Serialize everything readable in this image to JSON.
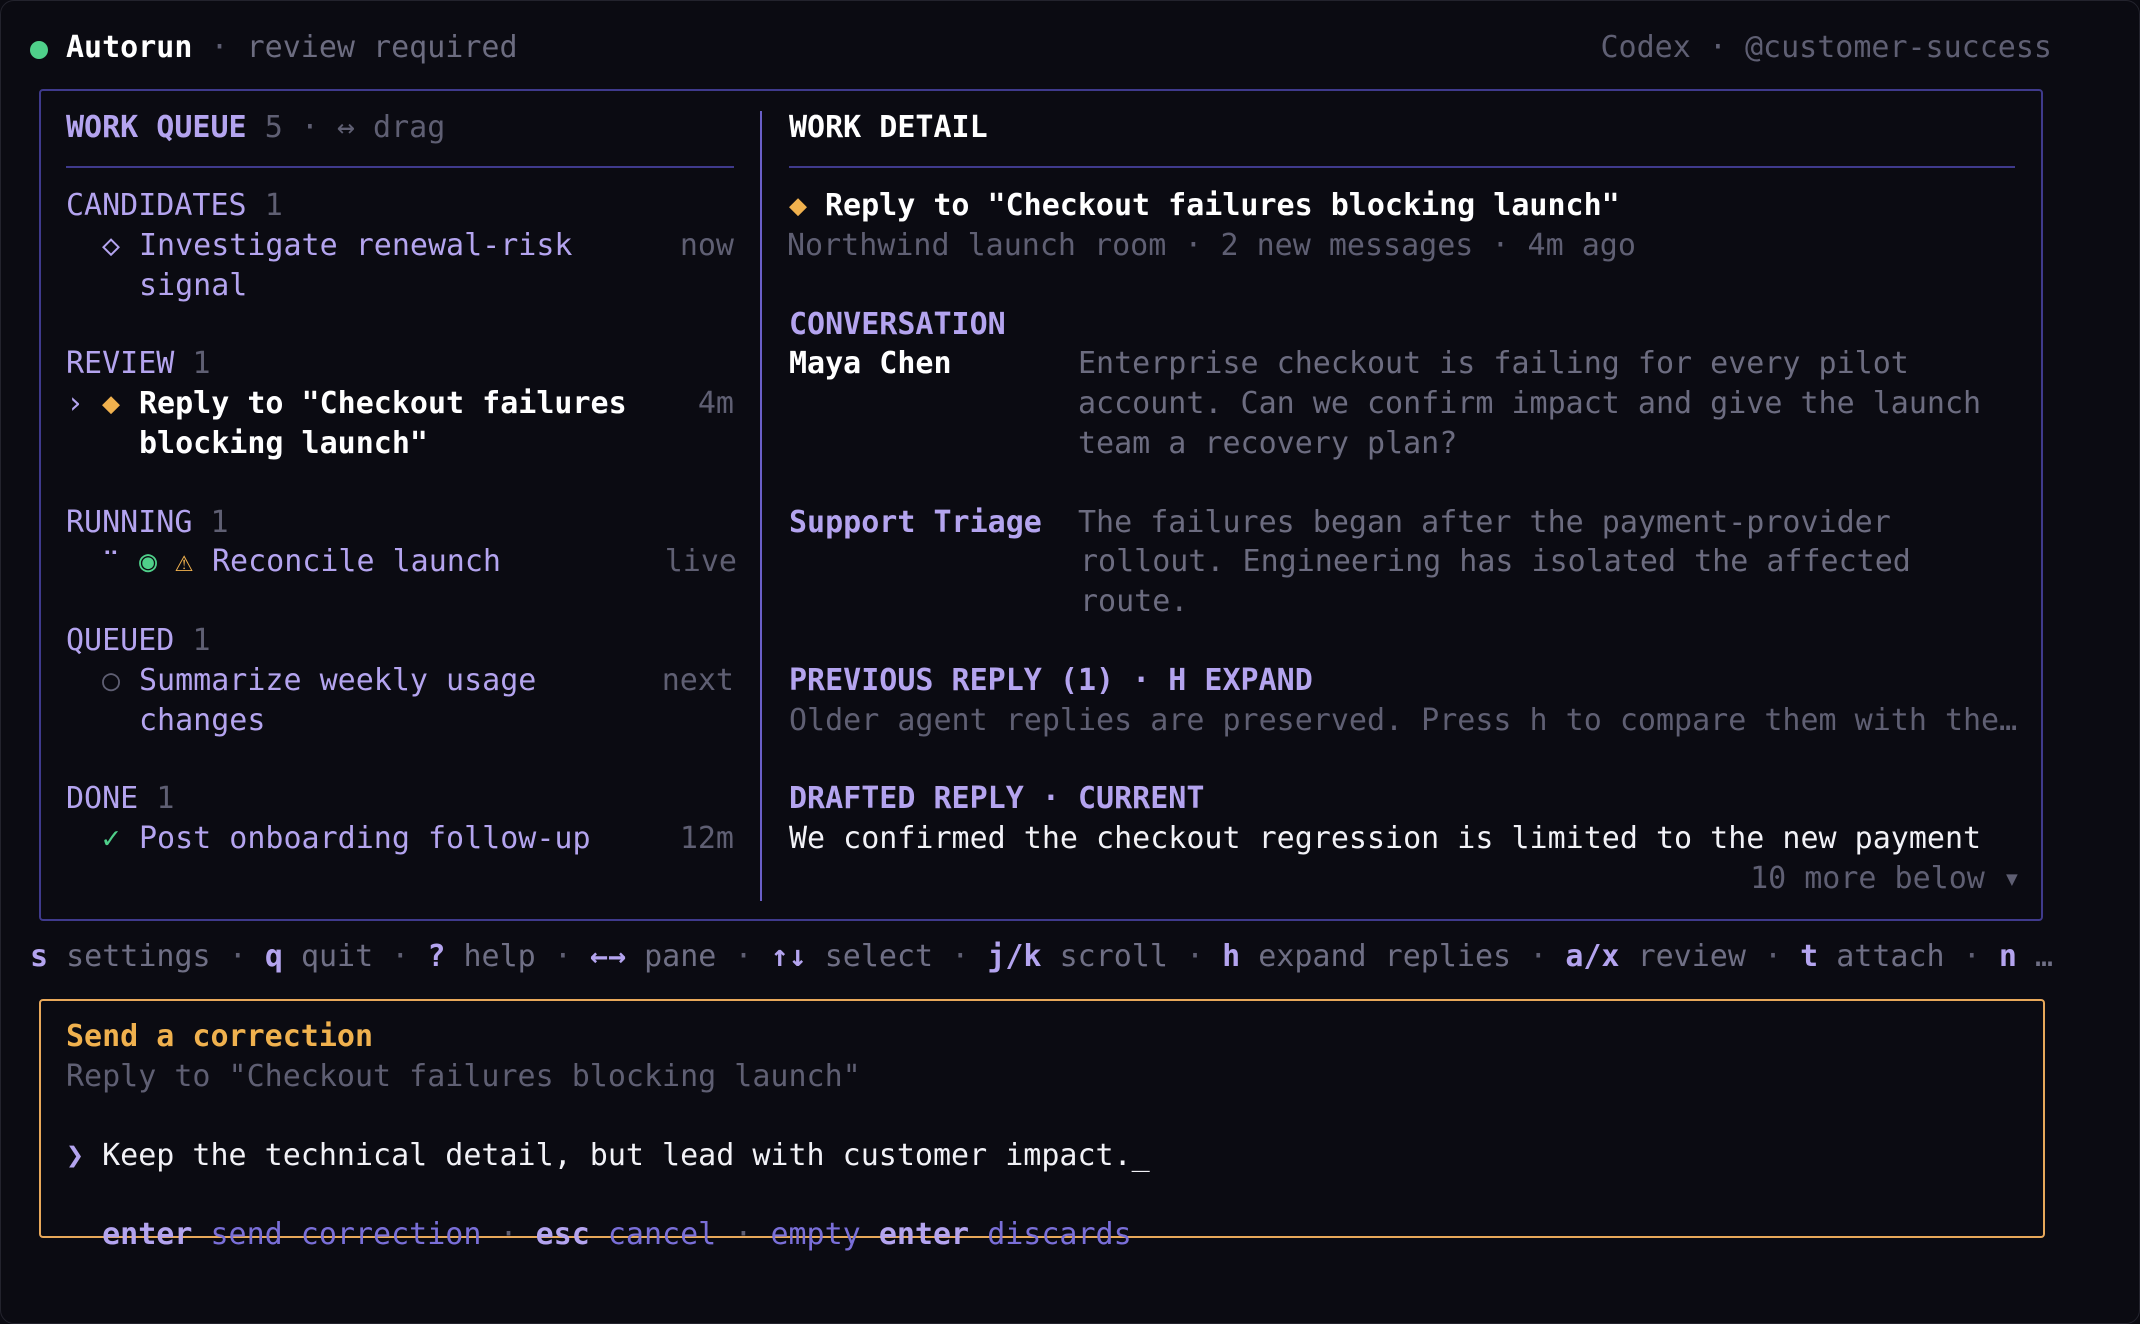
{
  "header": {
    "app_name": "Autorun",
    "sep": " · ",
    "status": "review required",
    "right": "Codex · @customer-success",
    "status_dot_color": "#4fd08a"
  },
  "queue": {
    "title": "WORK QUEUE",
    "count": "5",
    "drag_hint": "· ↔ drag",
    "groups": [
      {
        "label": "CANDIDATES",
        "count": "1",
        "items": [
          {
            "icon": "◇",
            "title_1": "Investigate renewal-risk",
            "title_2": "signal",
            "time": "now"
          }
        ]
      },
      {
        "label": "REVIEW",
        "count": "1",
        "items": [
          {
            "pointer": "›",
            "icon": "◆",
            "title_1": "Reply to \"Checkout failures",
            "title_2": "blocking launch\"",
            "time": "4m"
          }
        ]
      },
      {
        "label": "RUNNING",
        "count": "1",
        "items": [
          {
            "spinner": "⠉",
            "icon": "◉",
            "warn": "⚠",
            "title_1": "Reconcile launch",
            "time": "live"
          }
        ]
      },
      {
        "label": "QUEUED",
        "count": "1",
        "items": [
          {
            "icon": "○",
            "title_1": "Summarize weekly usage",
            "title_2": "changes",
            "time": "next"
          }
        ]
      },
      {
        "label": "DONE",
        "count": "1",
        "items": [
          {
            "icon": "✓",
            "title_1": "Post onboarding follow-up",
            "time": "12m"
          }
        ]
      }
    ]
  },
  "detail": {
    "title": "WORK DETAIL",
    "item_icon": "◆",
    "item_title": "Reply to \"Checkout failures blocking launch\"",
    "meta": "Northwind launch room · 2 new messages · 4m ago",
    "conversation_label": "CONVERSATION",
    "messages": [
      {
        "author": "Maya Chen",
        "lines": [
          "Enterprise checkout is failing for every pilot",
          "account. Can we confirm impact and give the launch",
          "team a recovery plan?"
        ]
      },
      {
        "author": "Support Triage",
        "lines": [
          "The failures began after the payment-provider",
          "rollout. Engineering has isolated the affected",
          "route."
        ]
      }
    ],
    "previous_label": "PREVIOUS REPLY (1) · H EXPAND",
    "previous_text": "Older agent replies are preserved. Press h to compare them with the…",
    "drafted_label": "DRAFTED REPLY · CURRENT",
    "drafted_text": "We confirmed the checkout regression is limited to the new payment",
    "more_below": "10 more below ▾"
  },
  "shortcuts": [
    {
      "key": "s",
      "label": "settings"
    },
    {
      "key": "q",
      "label": "quit"
    },
    {
      "key": "?",
      "label": "help"
    },
    {
      "key": "←→",
      "label": "pane"
    },
    {
      "key": "↑↓",
      "label": "select"
    },
    {
      "key": "j/k",
      "label": "scroll"
    },
    {
      "key": "h",
      "label": "expand replies"
    },
    {
      "key": "a/x",
      "label": "review"
    },
    {
      "key": "t",
      "label": "attach"
    },
    {
      "key": "n",
      "label": "…"
    }
  ],
  "shortcut_sep": "·",
  "correction": {
    "title": "Send a correction",
    "subtitle": "Reply to \"Checkout failures blocking launch\"",
    "prompt": "❯",
    "input_value": "Keep the technical detail, but lead with customer impact.",
    "cursor": "_",
    "hints": [
      {
        "key": "enter",
        "label": "send correction"
      },
      {
        "key": "esc",
        "label": "cancel"
      },
      {
        "prefix": "empty",
        "key": "enter",
        "label": "discards"
      }
    ],
    "hint_sep": "·"
  }
}
